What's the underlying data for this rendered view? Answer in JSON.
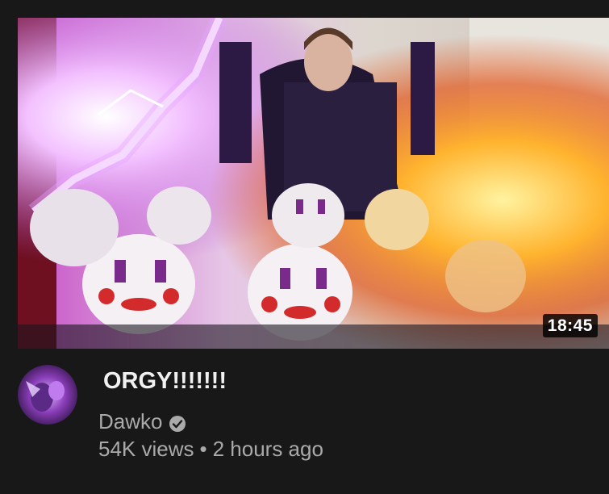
{
  "video": {
    "title": "ORGY!!!!!!!",
    "duration": "18:45",
    "channel": "Dawko",
    "views": "54K views",
    "separator": "•",
    "age": "2 hours ago",
    "thumbnail_icon": "video-thumbnail",
    "channel_verified_icon": "verified-check-icon"
  },
  "colors": {
    "background": "#181818",
    "title": "#f1f1f1",
    "meta": "#aaaaaa",
    "lightning": "#e7a6ff",
    "fire": "#ffb32e"
  }
}
